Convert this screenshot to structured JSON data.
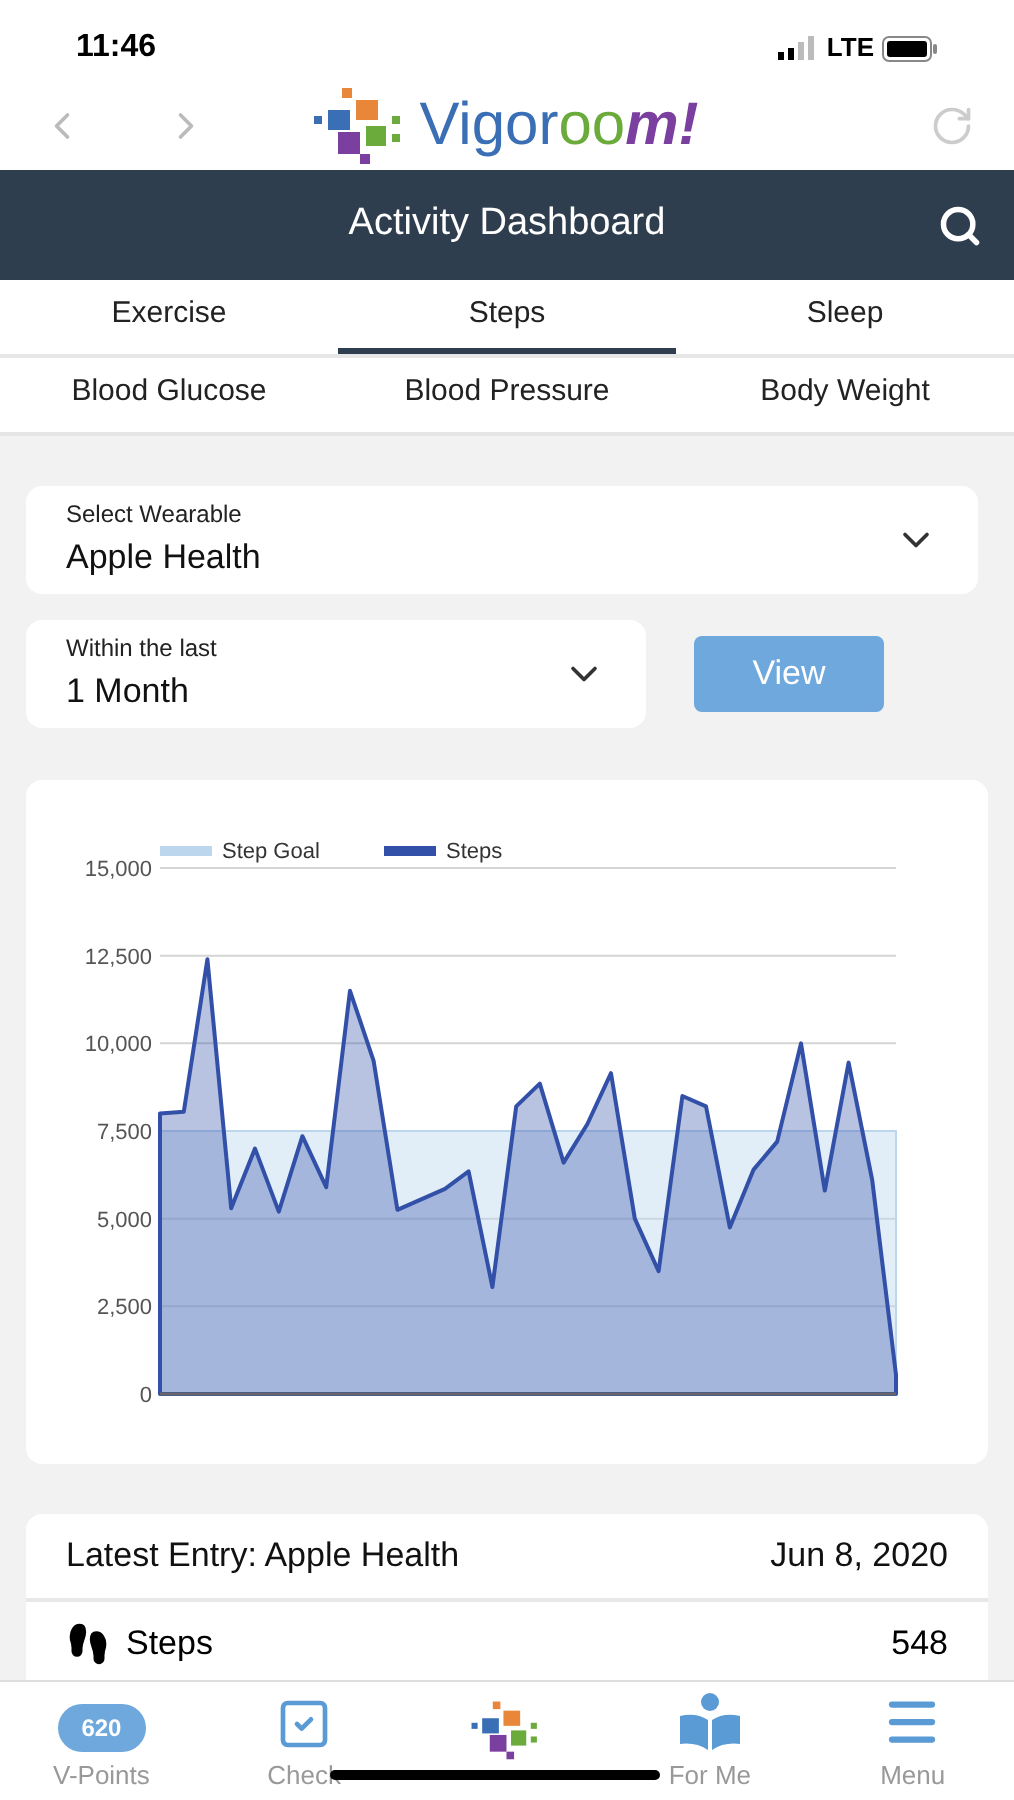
{
  "status_bar": {
    "time": "11:46",
    "network": "LTE"
  },
  "browser_bar": {
    "logo_text": "Vigoroom!"
  },
  "header": {
    "title": "Activity Dashboard"
  },
  "tab_rows": [
    {
      "tabs": [
        {
          "label": "Exercise",
          "selected": false
        },
        {
          "label": "Steps",
          "selected": true
        },
        {
          "label": "Sleep",
          "selected": false
        }
      ]
    },
    {
      "tabs": [
        {
          "label": "Blood Glucose",
          "selected": false
        },
        {
          "label": "Blood Pressure",
          "selected": false
        },
        {
          "label": "Body Weight",
          "selected": false
        }
      ]
    }
  ],
  "wearable_select": {
    "label": "Select Wearable",
    "value": "Apple Health"
  },
  "period_select": {
    "label": "Within the last",
    "value": "1 Month"
  },
  "view_button": "View",
  "chart": {
    "chart_data": {
      "type": "area",
      "grid": true,
      "legend": true,
      "yticks": [
        {
          "value": 0,
          "label": "0"
        },
        {
          "value": 2500,
          "label": "2,500"
        },
        {
          "value": 5000,
          "label": "5,000"
        },
        {
          "value": 7500,
          "label": "7,500"
        },
        {
          "value": 10000,
          "label": "10,000"
        },
        {
          "value": 12500,
          "label": "12,500"
        },
        {
          "value": 15000,
          "label": "15,000"
        }
      ],
      "ylim": [
        0,
        15000
      ],
      "series": [
        {
          "name": "Step Goal",
          "color": "#bcd6ee",
          "values": [
            7500,
            7500,
            7500,
            7500,
            7500,
            7500,
            7500,
            7500,
            7500,
            7500,
            7500,
            7500,
            7500,
            7500,
            7500,
            7500,
            7500,
            7500,
            7500,
            7500,
            7500,
            7500,
            7500,
            7500,
            7500,
            7500,
            7500,
            7500,
            7500,
            7500,
            7500,
            7500
          ]
        },
        {
          "name": "Steps",
          "color": "#3350a8",
          "values": [
            8000,
            8050,
            12400,
            5300,
            7000,
            5200,
            7350,
            5900,
            11500,
            9500,
            5250,
            5550,
            5850,
            6350,
            3050,
            8200,
            8850,
            6600,
            7700,
            9150,
            5000,
            3500,
            8500,
            8200,
            4750,
            6400,
            7200,
            10000,
            5800,
            9450,
            6100,
            550
          ]
        }
      ]
    }
  },
  "latest_entry": {
    "title": "Latest Entry: Apple Health",
    "date": "Jun 8, 2020",
    "metric": "Steps",
    "value": "548"
  },
  "bottom_nav": [
    {
      "kind": "badge",
      "badge": "620",
      "label": "V-Points"
    },
    {
      "kind": "checklist",
      "label": "Check"
    },
    {
      "kind": "logo"
    },
    {
      "kind": "reader",
      "label": "For Me"
    },
    {
      "kind": "menu",
      "label": "Menu"
    }
  ]
}
